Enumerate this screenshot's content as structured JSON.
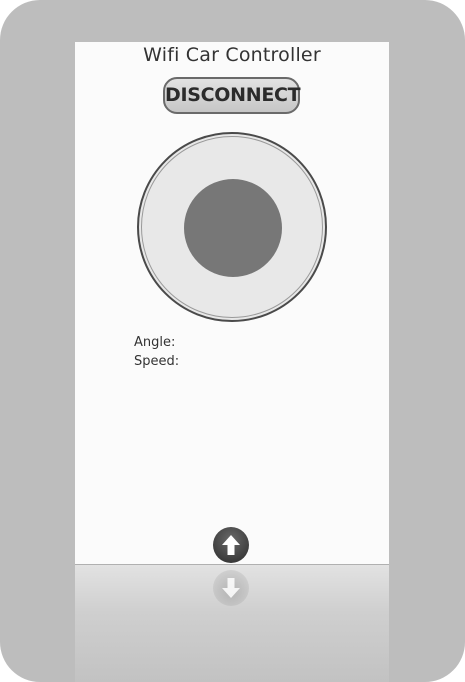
{
  "app": {
    "title": "Wifi Car Controller"
  },
  "controls": {
    "disconnect_label": "DISCONNECT"
  },
  "readouts": {
    "angle_label": "Angle:",
    "angle_value": "",
    "speed_label": "Speed:",
    "speed_value": ""
  },
  "icons": {
    "forward": "arrow-up-icon",
    "reverse": "arrow-down-icon"
  },
  "colors": {
    "joystick_base": "#e8e8e8",
    "joystick_knob": "#777777",
    "device_frame": "#bdbdbd"
  }
}
